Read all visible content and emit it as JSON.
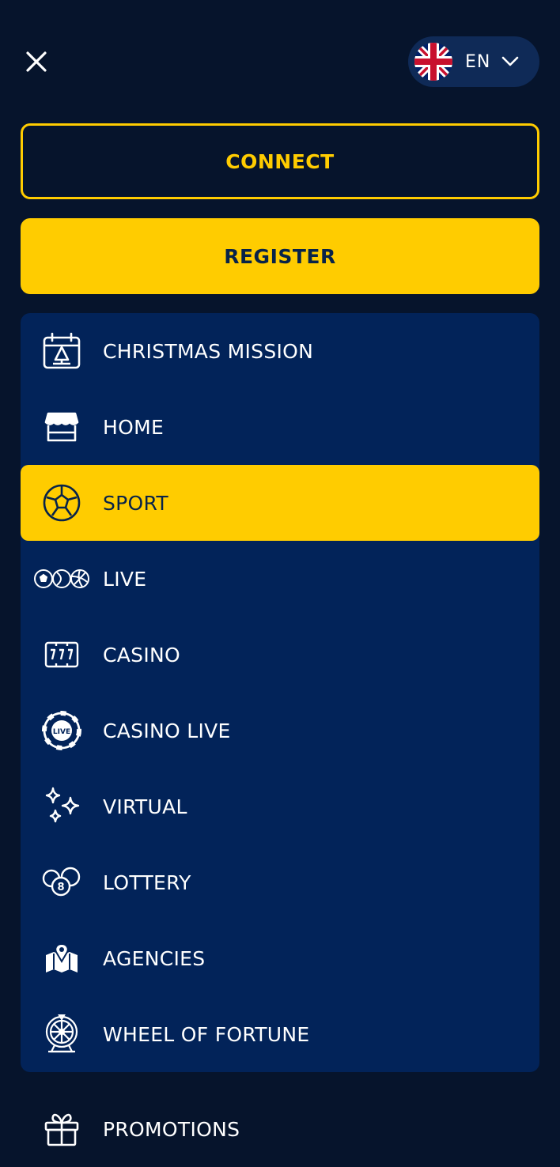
{
  "header": {
    "language": {
      "code": "EN"
    }
  },
  "auth": {
    "connect_label": "CONNECT",
    "register_label": "REGISTER"
  },
  "menu": {
    "items": [
      {
        "label": "CHRISTMAS MISSION",
        "icon": "calendar-tree-icon",
        "active": false
      },
      {
        "label": "HOME",
        "icon": "store-icon",
        "active": false
      },
      {
        "label": "SPORT",
        "icon": "soccer-ball-icon",
        "active": true
      },
      {
        "label": "LIVE",
        "icon": "sports-balls-icon",
        "active": false
      },
      {
        "label": "CASINO",
        "icon": "slot-777-icon",
        "active": false
      },
      {
        "label": "CASINO LIVE",
        "icon": "live-chip-icon",
        "active": false
      },
      {
        "label": "VIRTUAL",
        "icon": "sparkles-icon",
        "active": false
      },
      {
        "label": "LOTTERY",
        "icon": "lottery-balls-icon",
        "active": false
      },
      {
        "label": "AGENCIES",
        "icon": "map-pin-icon",
        "active": false
      },
      {
        "label": "WHEEL OF FORTUNE",
        "icon": "wheel-icon",
        "active": false
      }
    ]
  },
  "secondary": {
    "promotions_label": "PROMOTIONS",
    "promotions_icon": "gift-icon"
  },
  "colors": {
    "background": "#06142c",
    "panel": "#022359",
    "accent": "#ffcc00",
    "dark_text": "#082349"
  }
}
